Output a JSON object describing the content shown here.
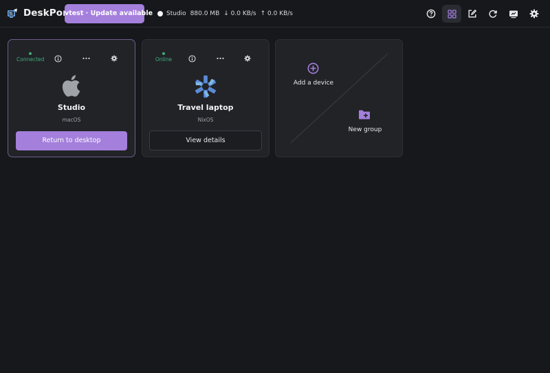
{
  "app": {
    "name": "DeskPort"
  },
  "update": {
    "label": "vtest · Update available"
  },
  "status": {
    "device": "Studio",
    "memory": "880.0 MB",
    "download": "↓ 0.0 KB/s",
    "upload": "↑ 0.0 KB/s"
  },
  "toolbar_icons": [
    "help-circle-icon",
    "grid-icon",
    "edit-icon",
    "refresh-icon",
    "screen-share-icon",
    "settings-gear-icon"
  ],
  "devices": [
    {
      "state": "Connected",
      "name": "Studio",
      "os": "macOS",
      "action": "Return to desktop",
      "os_icon": "apple-logo-icon"
    },
    {
      "state": "Online",
      "name": "Travel laptop",
      "os": "NixOS",
      "action": "View details",
      "os_icon": "nixos-logo-icon"
    }
  ],
  "add_card": {
    "add_device": "Add a device",
    "new_group": "New group"
  },
  "colors": {
    "accent": "#a47fdc",
    "online": "#3fae77",
    "background": "#16181b",
    "card": "#212327",
    "nix_blue": "#5a8ad6"
  }
}
